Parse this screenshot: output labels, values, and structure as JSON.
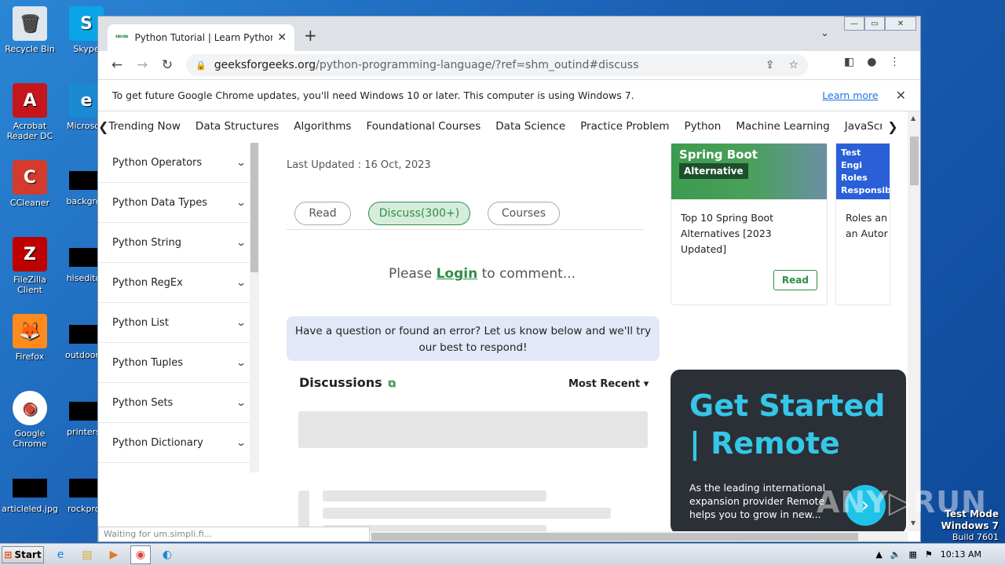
{
  "desktop": {
    "icons": [
      {
        "label": "Recycle Bin",
        "glyph": "🗑"
      },
      {
        "label": "Skype",
        "glyph": "S"
      },
      {
        "label": "Acrobat Reader DC",
        "glyph": "A"
      },
      {
        "label": "Microsoft",
        "glyph": "e"
      },
      {
        "label": "CCleaner",
        "glyph": "C"
      },
      {
        "label": "backgrou",
        "glyph": ""
      },
      {
        "label": "FileZilla Client",
        "glyph": "Z"
      },
      {
        "label": "hiseditor.",
        "glyph": ""
      },
      {
        "label": "Firefox",
        "glyph": "🦊"
      },
      {
        "label": "outdoorte",
        "glyph": ""
      },
      {
        "label": "Google Chrome",
        "glyph": "◉"
      },
      {
        "label": "printersp",
        "glyph": ""
      },
      {
        "label": "articleled.jpg",
        "glyph": ""
      },
      {
        "label": "rockproy",
        "glyph": ""
      }
    ],
    "watermark_os": "Test Mode",
    "watermark_win": "Windows 7",
    "watermark_build": "Build 7601",
    "anyrun": "ANY▷RUN"
  },
  "browser": {
    "tab_title": "Python Tutorial | Learn Python Progr",
    "tab_favicon": "ꟹꟹ",
    "new_tab": "+",
    "url_host": "geeksforgeeks.org",
    "url_path": "/python-programming-language/?ref=shm_outind#discuss",
    "infobar_text": "To get future Google Chrome updates, you'll need Windows 10 or later. This computer is using Windows 7.",
    "infobar_link": "Learn more",
    "status_text": "Waiting for um.simpli.fi..."
  },
  "topnav": {
    "items": [
      "Trending Now",
      "Data Structures",
      "Algorithms",
      "Foundational Courses",
      "Data Science",
      "Practice Problem",
      "Python",
      "Machine Learning",
      "JavaScript",
      "Ja"
    ]
  },
  "sidebar": {
    "items": [
      "Python Operators",
      "Python Data Types",
      "Python String",
      "Python RegEx",
      "Python List",
      "Python Tuples",
      "Python Sets",
      "Python Dictionary"
    ]
  },
  "main": {
    "last_updated": "Last Updated : 16 Oct, 2023",
    "pills": [
      "Read",
      "Discuss(300+)",
      "Courses"
    ],
    "login_pre": "Please ",
    "login_link": "Login",
    "login_post": " to comment...",
    "question": "Have a question or found an error? Let us know below and we'll try our best to respond!",
    "discussions": "Discussions",
    "sort": "Most Recent ▾"
  },
  "right": {
    "card1_thumb_title": "Spring Boot",
    "card1_thumb_alt": "Alternative",
    "card1_title": "Top 10 Spring Boot Alternatives [2023 Updated]",
    "card1_button": "Read",
    "card2_thumb": "Test Engi Roles Responsib",
    "card2_title_l1": "Roles an",
    "card2_title_l2": "an Autor",
    "ad_heading": "Get Started | Remote",
    "ad_text": "As the leading international expansion provider Remote helps you to grow in new..."
  },
  "taskbar": {
    "start": "Start",
    "clock": "10:13 AM"
  },
  "colors": {
    "accent": "#2f8d46",
    "link": "#1a73e8",
    "ad_bg": "#2b3036",
    "ad_heading": "#35c6e8"
  }
}
